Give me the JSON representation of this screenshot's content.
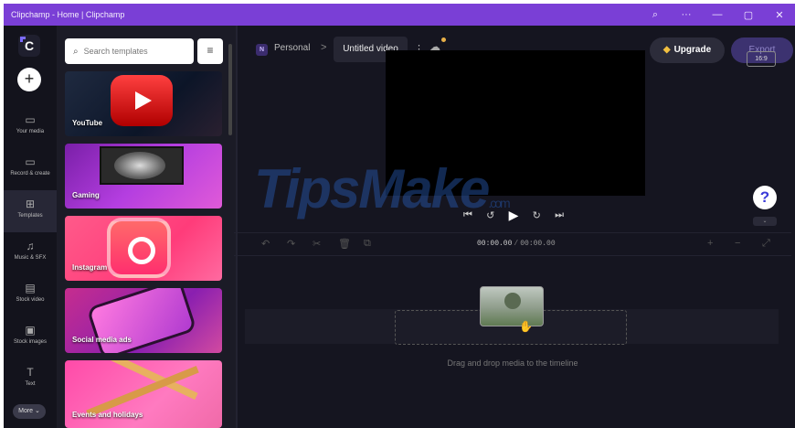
{
  "window": {
    "title": "Clipchamp - Home | Clipchamp",
    "controls": [
      "⌕",
      "···",
      "—",
      "▢",
      "✕"
    ]
  },
  "rail": {
    "logo": "C",
    "add": "+",
    "items": [
      {
        "label": "Your media",
        "icon": "folder-icon"
      },
      {
        "label": "Record & create",
        "icon": "camera-icon"
      },
      {
        "label": "Templates",
        "icon": "grid-icon"
      },
      {
        "label": "Music & SFX",
        "icon": "music-icon"
      },
      {
        "label": "Stock video",
        "icon": "film-icon"
      },
      {
        "label": "Stock images",
        "icon": "image-icon"
      },
      {
        "label": "Text",
        "icon": "text-icon"
      }
    ],
    "more": "More ⌄"
  },
  "templates": {
    "search_placeholder": "Search templates",
    "items": [
      "YouTube",
      "Gaming",
      "Instagram",
      "Social media ads",
      "Events and holidays"
    ]
  },
  "topbar": {
    "workspace_badge": "N",
    "workspace": "Personal",
    "separator": ">",
    "project_title": "Untitled video",
    "kebab": "⋮",
    "upgrade": "Upgrade",
    "export": "Export"
  },
  "preview": {
    "aspect_ratio": "16:9",
    "help": "?",
    "controls": [
      "⏮",
      "↺",
      "▶",
      "↻",
      "⏭"
    ]
  },
  "timeline": {
    "current_time": "00:00.00",
    "duration": "00:00.00",
    "hint": "Drag and drop media to the timeline"
  },
  "watermark": {
    "text": "TipsMake",
    "suffix": ".com"
  }
}
